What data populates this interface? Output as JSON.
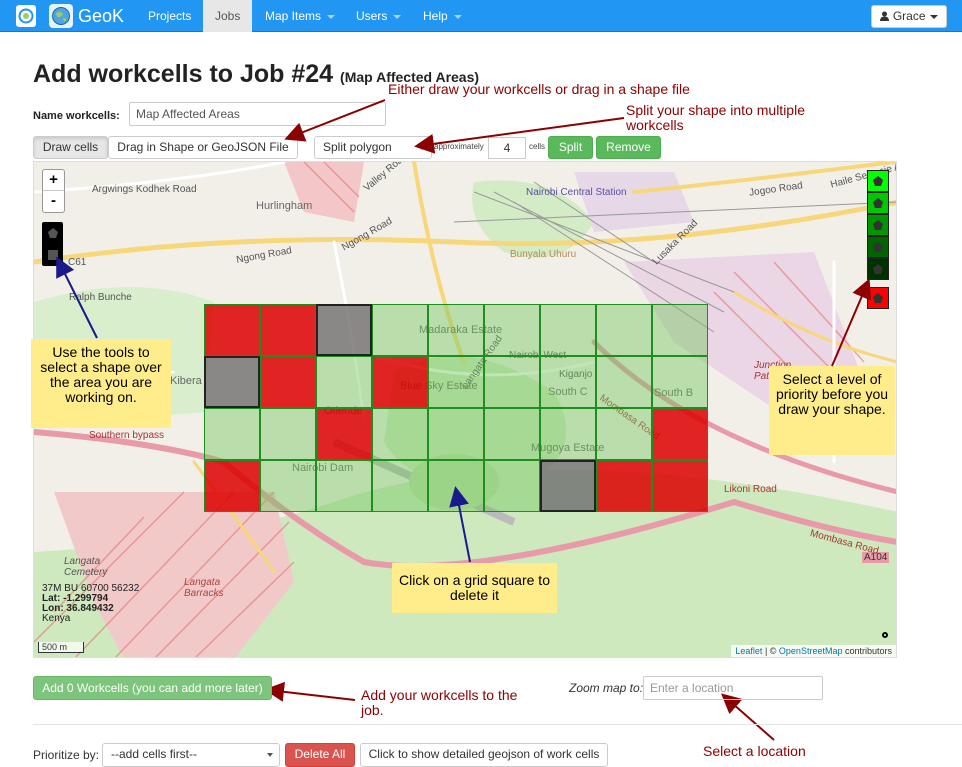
{
  "nav": {
    "brand": "GeoK",
    "items": [
      {
        "label": "Projects"
      },
      {
        "label": "Jobs"
      },
      {
        "label": "Map Items"
      },
      {
        "label": "Users"
      },
      {
        "label": "Help"
      }
    ],
    "user": "Grace",
    "accent": "#2196f3"
  },
  "page": {
    "title": "Add workcells to Job #24",
    "subtitle": "(Map Affected Areas)",
    "name_label": "Name workcells:",
    "name_value": "Map Affected Areas"
  },
  "toolbar": {
    "draw_cells": "Draw cells",
    "drag_shape": "Drag in Shape or GeoJSON File",
    "split_select": "Split polygon",
    "approximately": "approximately",
    "cells_count": "4",
    "cells_label": "cells",
    "split": "Split",
    "remove": "Remove"
  },
  "map": {
    "labels": {
      "argwings": "Argwings Kodhek Road",
      "hurlingham": "Hurlingham",
      "ngong1": "Ngong Road",
      "ngong2": "Ngong Road",
      "valley": "Valley Road",
      "nairobi_station": "Nairobi Central Station",
      "jogoo": "Jogoo Road",
      "haile": "Haile Selassie Avenue",
      "lusaka": "Lusaka Road",
      "bunyala": "Bunyala Uhuru",
      "c61": "C61",
      "ralph": "Ralph Bunche",
      "madaraka": "Madaraka Estate",
      "langata": "Langata Road",
      "nairobi_west": "Nairobi West",
      "kibera": "Kibera",
      "bluesky": "Blue Sky Estate",
      "southc": "South C",
      "southb": "South B",
      "kiganjo": "Kiganjo",
      "mombasa": "Mombasa Road",
      "mugoya": "Mugoya Estate",
      "southern": "Southern bypass",
      "nairobidam": "Nairobi Dam",
      "otiende": "Otiende",
      "langata_cemetery": "Langata Cemetery",
      "langata_barracks": "Langata Barracks",
      "a104": "A104",
      "mombasa2": "Mombasa Road",
      "likoni": "Likoni Road",
      "junction": "Junction Pathway"
    },
    "coords": {
      "grid": "37M BU 60700 56232",
      "lat": "Lat: -1.299794",
      "lon": "Lon: 36.849432",
      "country": "Kenya"
    },
    "scale": "500 m",
    "attribution": {
      "leaflet": "Leaflet",
      "sep": " | © ",
      "osm": "OpenStreetMap",
      "tail": " contributors"
    },
    "cells": [
      [
        "red",
        "red",
        "gray",
        "green",
        "green",
        "green",
        "green",
        "green",
        "green"
      ],
      [
        "gray",
        "red",
        "green",
        "red",
        "green",
        "green",
        "green",
        "green",
        "green"
      ],
      [
        "green",
        "green",
        "red",
        "green",
        "green",
        "green",
        "green",
        "green",
        "red"
      ],
      [
        "red",
        "green",
        "green",
        "green",
        "green",
        "green",
        "gray",
        "red",
        "red"
      ]
    ]
  },
  "callouts": {
    "tools": "Use the tools to select a shape over the area you are working on.",
    "priority": "Select a level of priority before you draw your shape.",
    "grid": "Click on a grid square to delete it"
  },
  "annotations": {
    "draw": "Either draw your workcells or drag in a shape file",
    "split": "Split your shape into multiple workcells",
    "add": "Add your workcells to the job.",
    "location": "Select a location"
  },
  "bottom": {
    "add_button": "Add 0 Workcells (you can add more later)",
    "zoom_label": "Zoom map to:",
    "zoom_placeholder": "Enter a location",
    "prioritize_label": "Prioritize by:",
    "prioritize_value": "--add cells first--",
    "delete_all": "Delete All",
    "show_geojson": "Click to show detailed geojson of work cells"
  }
}
